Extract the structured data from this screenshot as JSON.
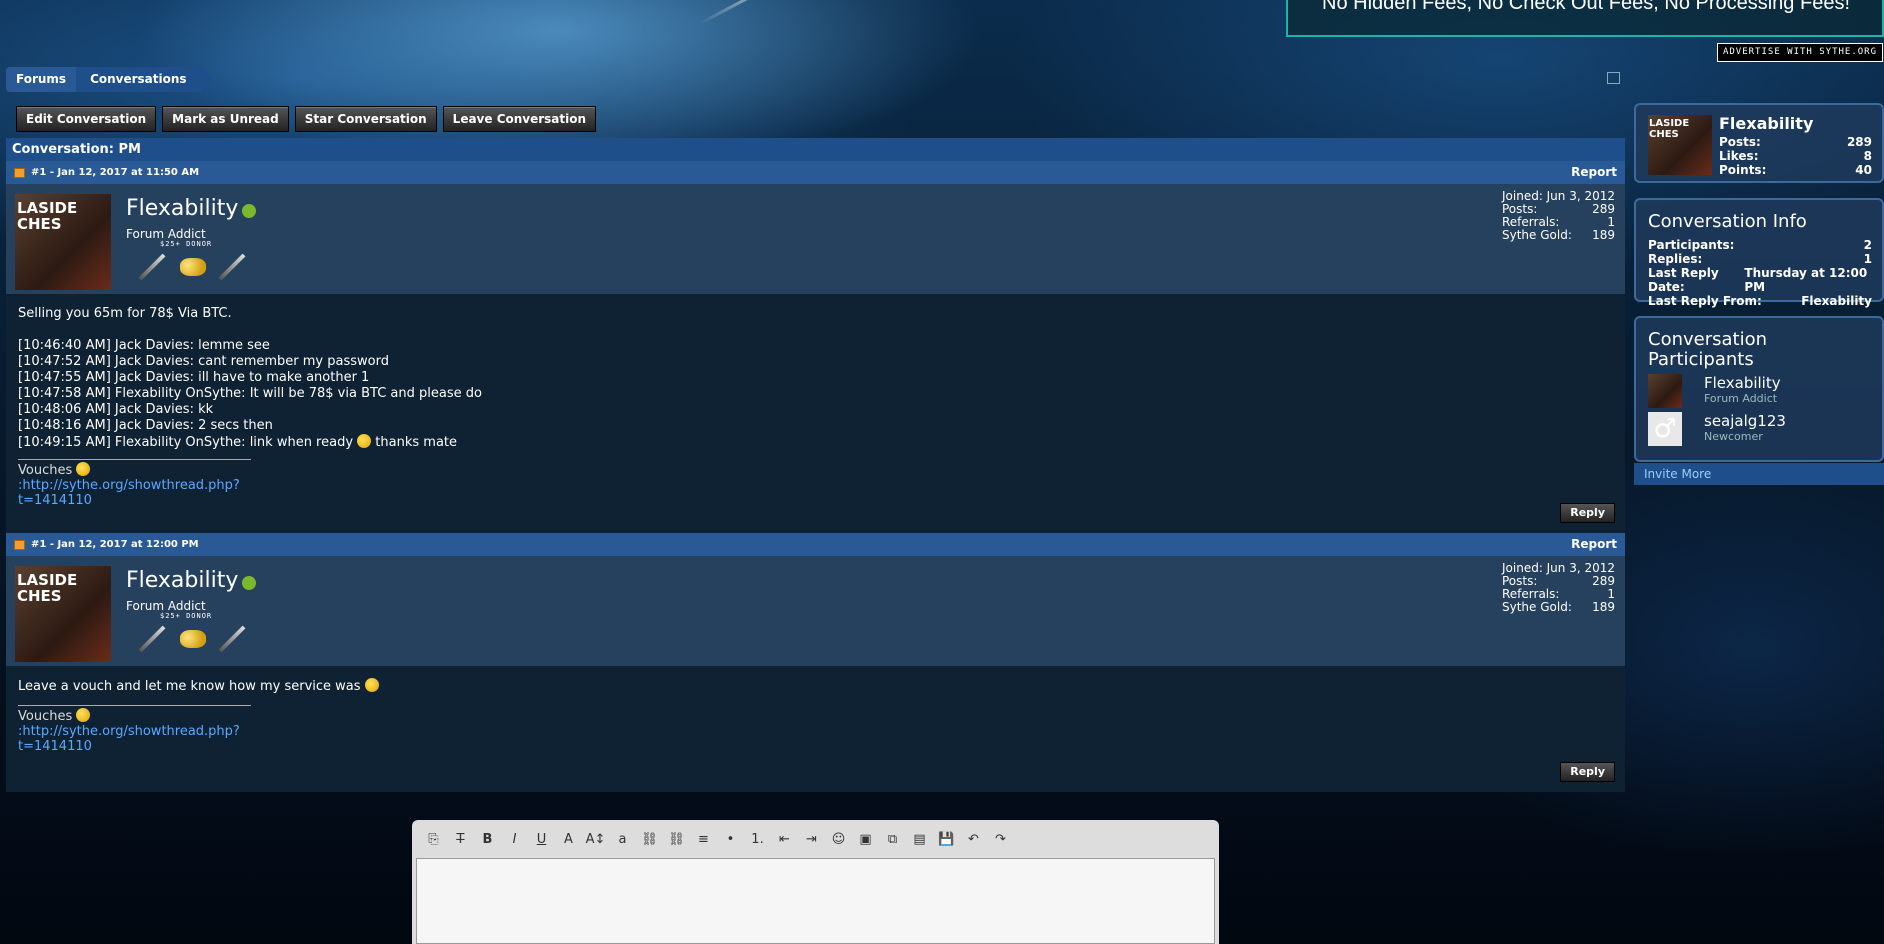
{
  "ad": {
    "text": "No Hidden Fees, No Check Out Fees, No Processing Fees!",
    "advertise": "ADVERTISE WITH SYTHE.ORG"
  },
  "breadcrumb": [
    "Forums",
    "Conversations"
  ],
  "actions": [
    "Edit Conversation",
    "Mark as Unread",
    "Star Conversation",
    "Leave Conversation"
  ],
  "conversation_title": "Conversation: PM",
  "messages": [
    {
      "header": "#1 - Jan 12, 2017 at 11:50 AM",
      "report": "Report",
      "user": {
        "name": "Flexability",
        "title": "Forum Addict",
        "donor": "$25+ DONOR",
        "avatar_text": "LASIDE\nCHES"
      },
      "stats": [
        [
          "Joined:",
          "Jun 3, 2012"
        ],
        [
          "Posts:",
          "289"
        ],
        [
          "Referrals:",
          "1"
        ],
        [
          "Sythe Gold:",
          "189"
        ]
      ],
      "lines": [
        "Selling you 65m for 78$ Via BTC.",
        "",
        "[10:46:40 AM] Jack Davies: lemme see",
        "[10:47:52 AM] Jack Davies: cant remember my password",
        "[10:47:55 AM] Jack Davies: ill have to make another 1",
        "[10:47:58 AM] Flexability OnSythe: It will be 78$ via BTC and please do",
        "[10:48:06 AM] Jack Davies: kk",
        "[10:48:16 AM] Jack Davies: 2 secs then"
      ],
      "last_line_a": "[10:49:15 AM] Flexability OnSythe: link when ready ",
      "last_line_b": " thanks mate",
      "sig_label": "Vouches ",
      "sig_link": ":http://sythe.org/showthread.php?t=1414110",
      "reply": "Reply"
    },
    {
      "header": "#1 - Jan 12, 2017 at 12:00 PM",
      "report": "Report",
      "user": {
        "name": "Flexability",
        "title": "Forum Addict",
        "donor": "$25+ DONOR",
        "avatar_text": "LASIDE\nCHES"
      },
      "stats": [
        [
          "Joined:",
          "Jun 3, 2012"
        ],
        [
          "Posts:",
          "289"
        ],
        [
          "Referrals:",
          "1"
        ],
        [
          "Sythe Gold:",
          "189"
        ]
      ],
      "text": "Leave a vouch and let me know how my service was ",
      "sig_label": "Vouches ",
      "sig_link": ":http://sythe.org/showthread.php?t=1414110",
      "reply": "Reply"
    }
  ],
  "visitor": {
    "name": "Flexability",
    "avatar_text": "LASIDE\nCHES",
    "stats": [
      [
        "Posts:",
        "289"
      ],
      [
        "Likes:",
        "8"
      ],
      [
        "Points:",
        "40"
      ]
    ]
  },
  "info": {
    "title": "Conversation Info",
    "rows": [
      [
        "Participants:",
        "2"
      ],
      [
        "Replies:",
        "1"
      ],
      [
        "Last Reply Date:",
        "Thursday at 12:00 PM"
      ],
      [
        "Last Reply From:",
        "Flexability"
      ]
    ]
  },
  "participants": {
    "title": "Conversation Participants",
    "list": [
      {
        "name": "Flexability",
        "title": "Forum Addict"
      },
      {
        "name": "seajalg123",
        "title": "Newcomer"
      }
    ],
    "invite": "Invite More"
  },
  "editor_tools": [
    "⎘",
    "T̶",
    "B",
    "I",
    "U",
    "A",
    "A↕",
    "a",
    "⛓",
    "⛓",
    "≡",
    "•",
    "1.",
    "⇤",
    "⇥",
    "☺",
    "▣",
    "⧉",
    "▤",
    "💾",
    "↶",
    "↷"
  ]
}
